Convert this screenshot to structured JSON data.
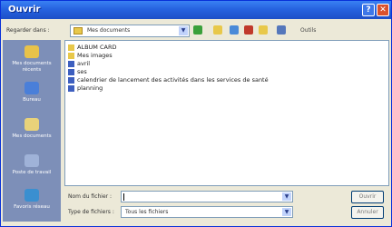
{
  "window": {
    "title": "Ouvrir",
    "help_label": "?",
    "close_label": "✕"
  },
  "toolbar": {
    "lookin_label": "Regarder dans :",
    "lookin_value": "Mes documents",
    "views_label": "Outils"
  },
  "places": [
    {
      "label": "Mes documents récents",
      "icon": "recent-documents-icon",
      "color": "#e8c24a"
    },
    {
      "label": "Bureau",
      "icon": "desktop-icon",
      "color": "#4a7fd9"
    },
    {
      "label": "Mes documents",
      "icon": "my-documents-icon",
      "color": "#e8d27a"
    },
    {
      "label": "Poste de travail",
      "icon": "my-computer-icon",
      "color": "#9fb2d8"
    },
    {
      "label": "Favoris réseau",
      "icon": "network-places-icon",
      "color": "#3a8fd0"
    }
  ],
  "files": [
    {
      "name": "ALBUM CARD",
      "icon": "folder-icon",
      "color": "#e8c84a"
    },
    {
      "name": "Mes images",
      "icon": "folder-icon",
      "color": "#e8c84a"
    },
    {
      "name": "avril",
      "icon": "document-icon",
      "color": "#3d5fbf"
    },
    {
      "name": "ses",
      "icon": "document-icon",
      "color": "#3d5fbf"
    },
    {
      "name": "calendrier de lancement des activités dans les services de santé",
      "icon": "document-icon",
      "color": "#3d5fbf"
    },
    {
      "name": "planning",
      "icon": "document-icon",
      "color": "#3d5fbf"
    }
  ],
  "filename_field": {
    "label": "Nom du fichier :",
    "value": ""
  },
  "filetype_field": {
    "label": "Type de fichiers :",
    "value": "Tous les fichiers"
  },
  "buttons": {
    "open_label": "Ouvrir",
    "cancel_label": "Annuler"
  }
}
